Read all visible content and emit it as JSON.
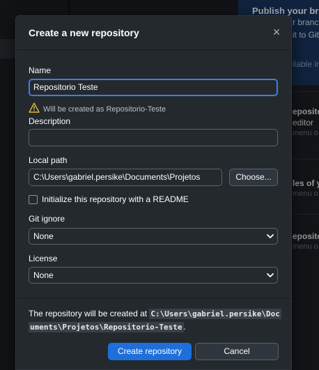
{
  "background": {
    "publish_card": {
      "title": "Publish your branc",
      "line1": "r branch",
      "line2": "it to Git",
      "line3": "ilable in"
    },
    "items": [
      {
        "title": "eposito",
        "subtitle": "editor",
        "hint": "menu o"
      },
      {
        "title": "les of y",
        "hint": "menu o"
      },
      {
        "title": "eposito",
        "hint": "menu o"
      }
    ]
  },
  "dialog": {
    "title": "Create a new repository",
    "close_glyph": "×",
    "name": {
      "label": "Name",
      "value": "Repositorio Teste"
    },
    "warning": {
      "text": "Will be created as Repositorio-Teste"
    },
    "description": {
      "label": "Description",
      "value": ""
    },
    "local_path": {
      "label": "Local path",
      "value": "C:\\Users\\gabriel.persike\\Documents\\Projetos",
      "choose_label": "Choose..."
    },
    "readme": {
      "label": "Initialize this repository with a README",
      "checked": false
    },
    "git_ignore": {
      "label": "Git ignore",
      "selected": "None"
    },
    "license": {
      "label": "License",
      "selected": "None"
    },
    "footer": {
      "prefix": "The repository will be created at ",
      "path": "C:\\Users\\gabriel.persike\\Documents\\Projetos\\Repositorio-Teste",
      "suffix": ".",
      "create_label": "Create repository",
      "cancel_label": "Cancel"
    }
  },
  "colors": {
    "accent": "#1e6fd9",
    "focus": "#3d7ee8",
    "warning": "#e3b341",
    "dialog_bg": "#24292e"
  }
}
